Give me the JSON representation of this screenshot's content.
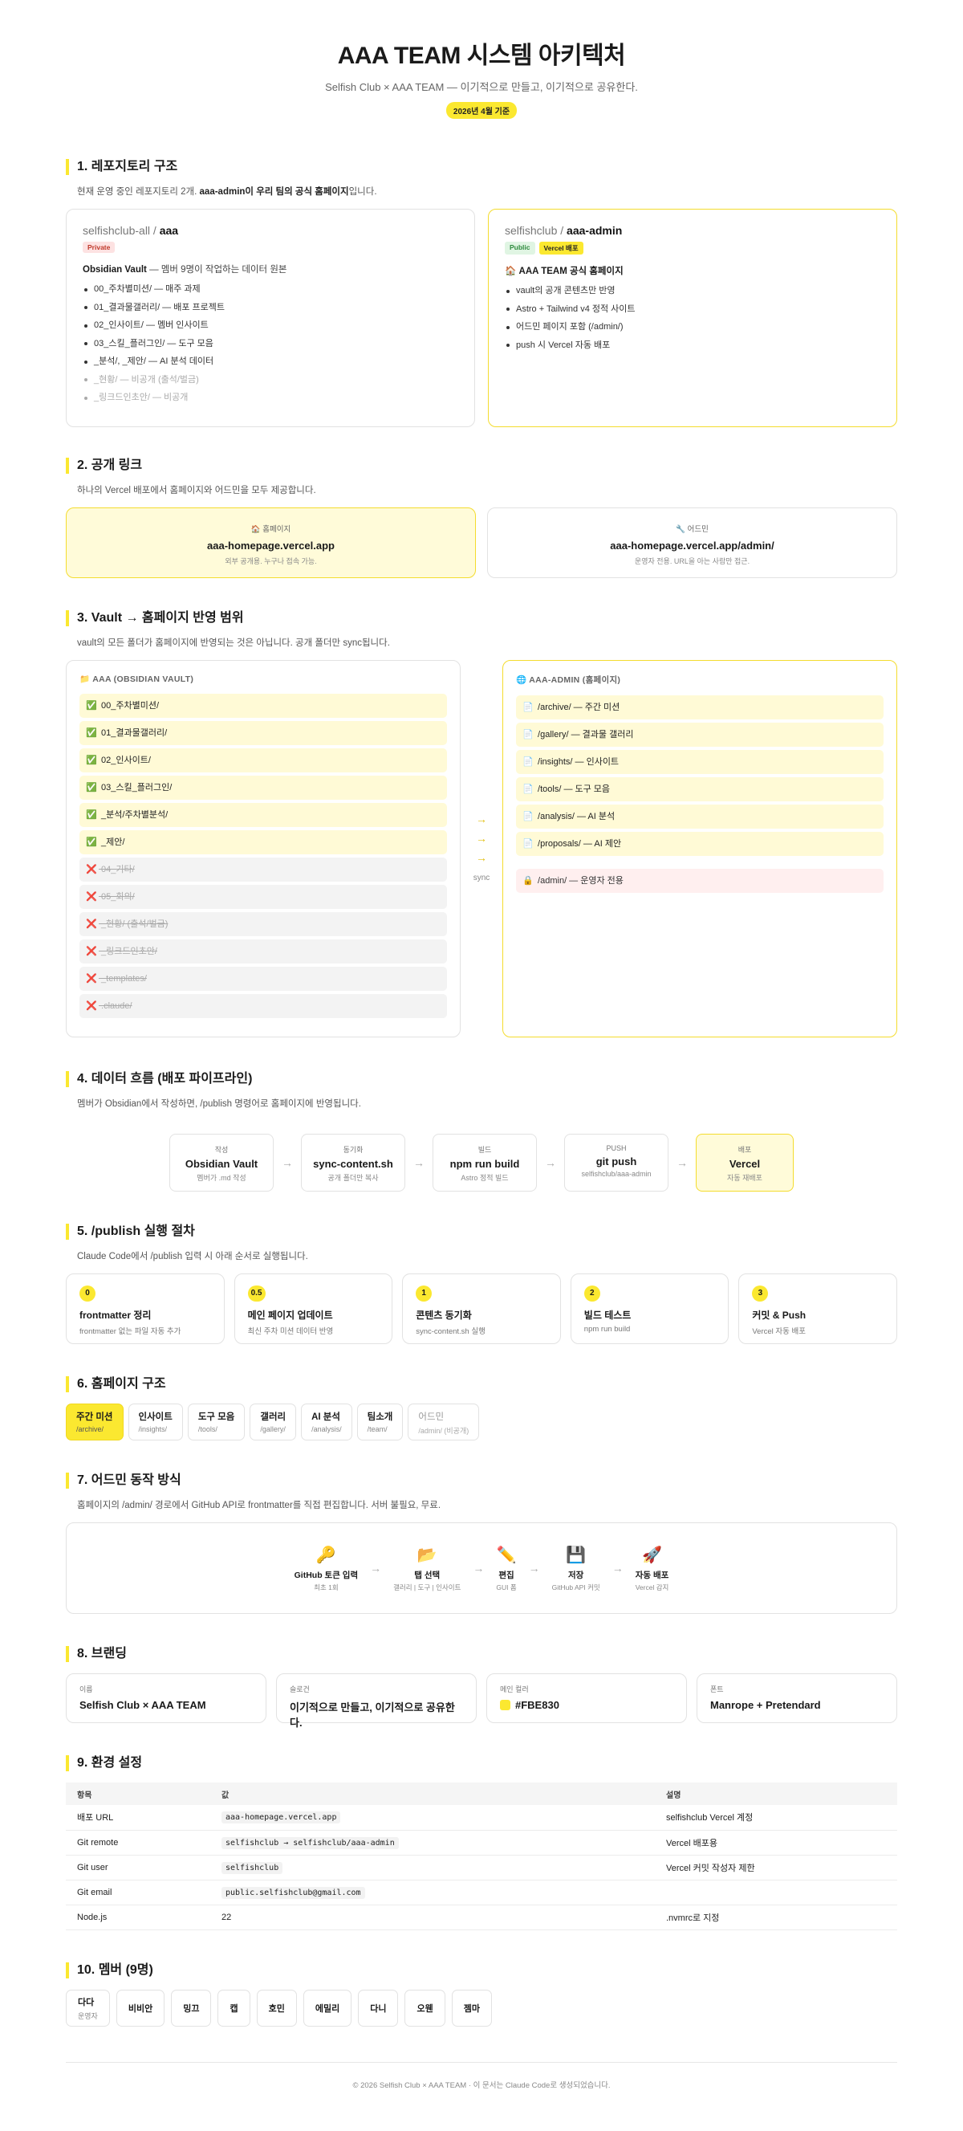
{
  "header": {
    "title": "AAA TEAM 시스템 아키텍처",
    "subtitle": "Selfish Club × AAA TEAM — 이기적으로 만들고, 이기적으로 공유한다.",
    "date_badge": "2026년 4월 기준"
  },
  "s1": {
    "heading": "1. 레포지토리 구조",
    "desc_pre": "현재 운영 중인 레포지토리 2개. ",
    "desc_bold": "aaa-admin이 우리 팀의 공식 홈페이지",
    "desc_post": "입니다.",
    "repos": [
      {
        "owner": "selfishclub-all / ",
        "name": "aaa",
        "tags": [
          "Private"
        ],
        "title": "Obsidian Vault",
        "title_rest": " — 멤버 9명이 작업하는 데이터 원본",
        "items": [
          "00_주차별미션/ — 매주 과제",
          "01_결과물갤러리/ — 배포 프로젝트",
          "02_인사이트/ — 멤버 인사이트",
          "03_스킬_플러그인/ — 도구 모음",
          "_분석/, _제안/ — AI 분석 데이터"
        ],
        "muted_items": [
          "_현황/ — 비공개 (출석/벌금)",
          "_링크드인초안/ — 비공개"
        ]
      },
      {
        "owner": "selfishclub / ",
        "name": "aaa-admin",
        "tags": [
          "Public",
          "Vercel 배포"
        ],
        "title_icon": "🏠",
        "title": "AAA TEAM 공식 홈페이지",
        "title_rest": "",
        "items": [
          "vault의 공개 콘텐츠만 반영",
          "Astro + Tailwind v4 정적 사이트",
          "어드민 페이지 포함 (/admin/)",
          "push 시 Vercel 자동 배포"
        ],
        "muted_items": []
      }
    ]
  },
  "s2": {
    "heading": "2. 공개 링크",
    "desc": "하나의 Vercel 배포에서 홈페이지와 어드민을 모두 제공합니다.",
    "links": [
      {
        "icon": "🏠",
        "label": "홈페이지",
        "url": "aaa-homepage.vercel.app",
        "note": "외부 공개용. 누구나 접속 가능."
      },
      {
        "icon": "🔧",
        "label": "어드민",
        "url": "aaa-homepage.vercel.app/admin/",
        "note": "운영자 전용. URL을 아는 사람만 접근."
      }
    ]
  },
  "s3": {
    "heading": "3. Vault → 홈페이지 반영 범위",
    "desc": "vault의 모든 폴더가 홈페이지에 반영되는 것은 아닙니다. 공개 폴더만 sync됩니다.",
    "left_header": "📁 AAA (OBSIDIAN VAULT)",
    "right_header": "🌐 AAA-ADMIN (홈페이지)",
    "sync_label": "sync",
    "left_yes": [
      "00_주차별미션/",
      "01_결과물갤러리/",
      "02_인사이트/",
      "03_스킬_플러그인/",
      "_분석/주차별분석/",
      "_제안/"
    ],
    "left_no": [
      "04_기타/",
      "05_회의/",
      "_현황/ (출석/벌금)",
      "_링크드인초안/",
      "_templates/",
      ".claude/"
    ],
    "right_yes": [
      "/archive/ — 주간 미션",
      "/gallery/ — 결과물 갤러리",
      "/insights/ — 인사이트",
      "/tools/ — 도구 모음",
      "/analysis/ — AI 분석",
      "/proposals/ — AI 제안"
    ],
    "right_admin": "/admin/ — 운영자 전용"
  },
  "s4": {
    "heading": "4. 데이터 흐름 (배포 파이프라인)",
    "desc": "멤버가 Obsidian에서 작성하면, /publish 명령어로 홈페이지에 반영됩니다.",
    "flow": [
      {
        "k": "작성",
        "v": "Obsidian Vault",
        "s": "멤버가 .md 작성"
      },
      {
        "k": "동기화",
        "v": "sync-content.sh",
        "s": "공개 폴더만 복사"
      },
      {
        "k": "빌드",
        "v": "npm run build",
        "s": "Astro 정적 빌드"
      },
      {
        "k": "PUSH",
        "v": "git push",
        "s": "selfishclub/aaa-admin"
      },
      {
        "k": "배포",
        "v": "Vercel",
        "s": "자동 재배포"
      }
    ]
  },
  "s5": {
    "heading": "5. /publish 실행 절차",
    "desc": "Claude Code에서 /publish 입력 시 아래 순서로 실행됩니다.",
    "steps": [
      {
        "n": "0",
        "t": "frontmatter 정리",
        "d": "frontmatter 없는 파일 자동 추가"
      },
      {
        "n": "0.5",
        "t": "메인 페이지 업데이트",
        "d": "최신 주차 미션 데이터 반영"
      },
      {
        "n": "1",
        "t": "콘텐츠 동기화",
        "d": "sync-content.sh 실행"
      },
      {
        "n": "2",
        "t": "빌드 테스트",
        "d": "npm run build"
      },
      {
        "n": "3",
        "t": "커밋 & Push",
        "d": "Vercel 자동 배포"
      }
    ]
  },
  "s6": {
    "heading": "6. 홈페이지 구조",
    "tabs": [
      {
        "n": "주간 미션",
        "p": "/archive/"
      },
      {
        "n": "인사이트",
        "p": "/insights/"
      },
      {
        "n": "도구 모음",
        "p": "/tools/"
      },
      {
        "n": "갤러리",
        "p": "/gallery/"
      },
      {
        "n": "AI 분석",
        "p": "/analysis/"
      },
      {
        "n": "팀소개",
        "p": "/team/"
      },
      {
        "n": "어드민",
        "p": "/admin/ (비공개)"
      }
    ]
  },
  "s7": {
    "heading": "7. 어드민 동작 방식",
    "desc": "홈페이지의 /admin/ 경로에서 GitHub API로 frontmatter를 직접 편집합니다. 서버 불필요, 무료.",
    "steps": [
      {
        "icon": "🔑",
        "t": "GitHub 토큰 입력",
        "d": "최초 1회"
      },
      {
        "icon": "📂",
        "t": "탭 선택",
        "d": "갤러리 | 도구 | 인사이트"
      },
      {
        "icon": "✏️",
        "t": "편집",
        "d": "GUI 폼"
      },
      {
        "icon": "💾",
        "t": "저장",
        "d": "GitHub API 커밋"
      },
      {
        "icon": "🚀",
        "t": "자동 배포",
        "d": "Vercel 감지"
      }
    ]
  },
  "s8": {
    "heading": "8. 브랜딩",
    "items": [
      {
        "k": "이름",
        "v": "Selfish Club × AAA TEAM"
      },
      {
        "k": "슬로건",
        "v": "이기적으로 만들고, 이기적으로 공유한다."
      },
      {
        "k": "메인 컬러",
        "v": "#FBE830",
        "color": "#FBE830"
      },
      {
        "k": "폰트",
        "v": "Manrope + Pretendard"
      }
    ]
  },
  "s9": {
    "heading": "9. 환경 설정",
    "headers": [
      "항목",
      "값",
      "설명"
    ],
    "rows": [
      {
        "k": "배포 URL",
        "v": "aaa-homepage.vercel.app",
        "d": "selfishclub Vercel 계정",
        "code": true
      },
      {
        "k": "Git remote",
        "v": "selfishclub → selfishclub/aaa-admin",
        "d": "Vercel 배포용",
        "code": true
      },
      {
        "k": "Git user",
        "v": "selfishclub",
        "d": "Vercel 커밋 작성자 제한",
        "code": true
      },
      {
        "k": "Git email",
        "v": "public.selfishclub@gmail.com",
        "d": "",
        "code": true
      },
      {
        "k": "Node.js",
        "v": "22",
        "d": ".nvmrc로 지정",
        "code": false
      }
    ]
  },
  "s10": {
    "heading": "10. 멤버 (9명)",
    "members": [
      {
        "n": "다다",
        "r": "운영자"
      },
      {
        "n": "비비안",
        "r": ""
      },
      {
        "n": "밍끄",
        "r": ""
      },
      {
        "n": "캡",
        "r": ""
      },
      {
        "n": "호민",
        "r": ""
      },
      {
        "n": "에밀리",
        "r": ""
      },
      {
        "n": "다니",
        "r": ""
      },
      {
        "n": "오웬",
        "r": ""
      },
      {
        "n": "젬마",
        "r": ""
      }
    ]
  },
  "footer": "© 2026 Selfish Club × AAA TEAM · 이 문서는 Claude Code로 생성되었습니다."
}
